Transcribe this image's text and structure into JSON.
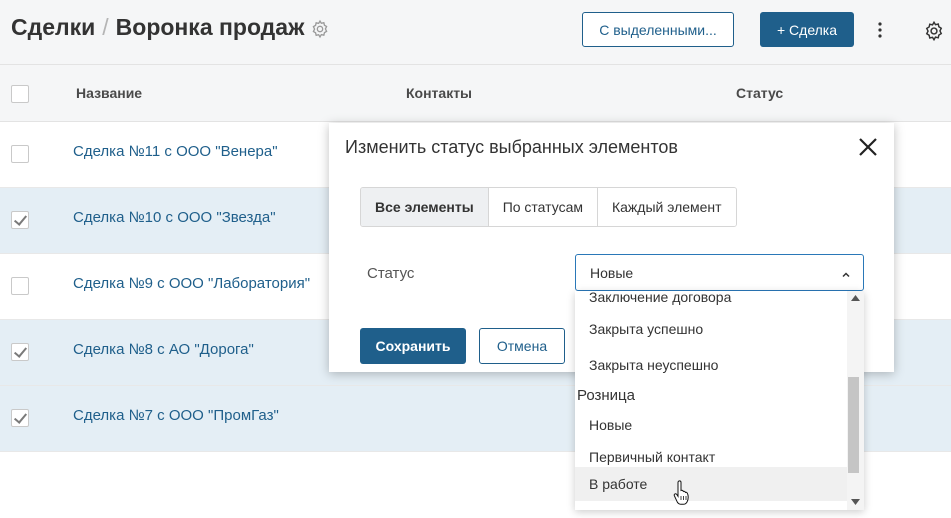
{
  "header": {
    "breadcrumb_root": "Сделки",
    "separator": "/",
    "page_title": "Воронка продаж",
    "bulk_button": "С выделенными...",
    "add_button": "+ Сделка",
    "more_icon": "kebab-icon",
    "settings_icon": "gear-icon"
  },
  "table": {
    "columns": [
      "Название",
      "Контакты",
      "Статус"
    ],
    "rows": [
      {
        "name": "Сделка №11 с ООО \"Венера\"",
        "checked": false
      },
      {
        "name": "Сделка №10 с ООО \"Звезда\"",
        "checked": true
      },
      {
        "name": "Сделка №9 с ООО \"Лаборатория\"",
        "checked": false
      },
      {
        "name": "Сделка №8 с АО \"Дорога\"",
        "checked": true
      },
      {
        "name": "Сделка №7 с ООО \"ПромГаз\"",
        "checked": true
      }
    ]
  },
  "modal": {
    "title": "Изменить статус выбранных элементов",
    "tabs": [
      {
        "label": "Все элементы",
        "active": true
      },
      {
        "label": "По статусам",
        "active": false
      },
      {
        "label": "Каждый элемент",
        "active": false
      }
    ],
    "status_label": "Статус",
    "save_button": "Сохранить",
    "cancel_button": "Отмена"
  },
  "status_select": {
    "value": "Новые",
    "options": [
      {
        "label": "Заключение договора",
        "group": false
      },
      {
        "label": "Закрыта успешно",
        "group": false
      },
      {
        "label": "Закрыта неуспешно",
        "group": false
      },
      {
        "label": "Розница",
        "group": true
      },
      {
        "label": "Новые",
        "group": false
      },
      {
        "label": "Первичный контакт",
        "group": false
      },
      {
        "label": "В работе",
        "group": false,
        "hover": true
      }
    ]
  },
  "colors": {
    "primary": "#1f5f8b",
    "selected_row": "#e4eef5",
    "focus_border": "#2a78b8"
  }
}
